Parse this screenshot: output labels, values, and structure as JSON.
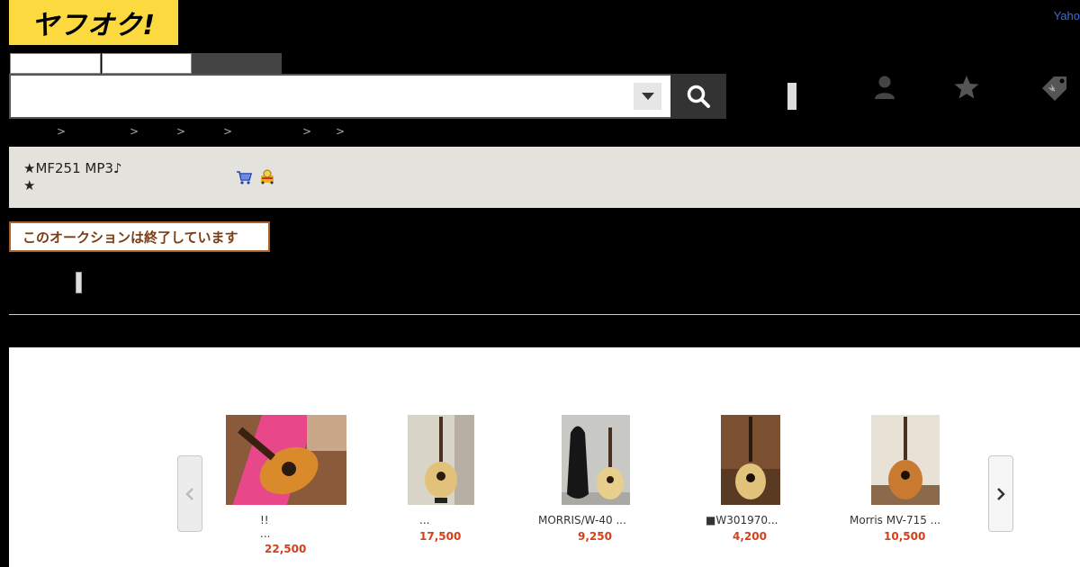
{
  "header": {
    "logo_text": "ヤフオク!",
    "yahoo_link": "Yaho",
    "search": {
      "value": "",
      "placeholder": ""
    }
  },
  "breadcrumb": [
    ">",
    ">",
    ">",
    ">",
    ">",
    ">"
  ],
  "item": {
    "title": "★MF251 MP3♪\n★"
  },
  "status": {
    "ended_banner": "このオークションは終了しています"
  },
  "related": {
    "items": [
      {
        "name": "!!\n...",
        "price": "22,500"
      },
      {
        "name": "...",
        "price": "17,500"
      },
      {
        "name": "MORRIS/W-40 ...",
        "price": "9,250"
      },
      {
        "name": "■W301970...",
        "price": "4,200"
      },
      {
        "name": "Morris MV-715 ...",
        "price": "10,500"
      }
    ]
  },
  "colors": {
    "logo_yellow": "#fcd93f",
    "price_red": "#d4401a",
    "banner_border": "#a9602b"
  },
  "icons": [
    "search-icon",
    "user-icon",
    "star-icon",
    "tag-icon",
    "cart-icon",
    "buy-now-icon",
    "chevron-left-icon",
    "chevron-right-icon",
    "chevron-down-icon"
  ]
}
